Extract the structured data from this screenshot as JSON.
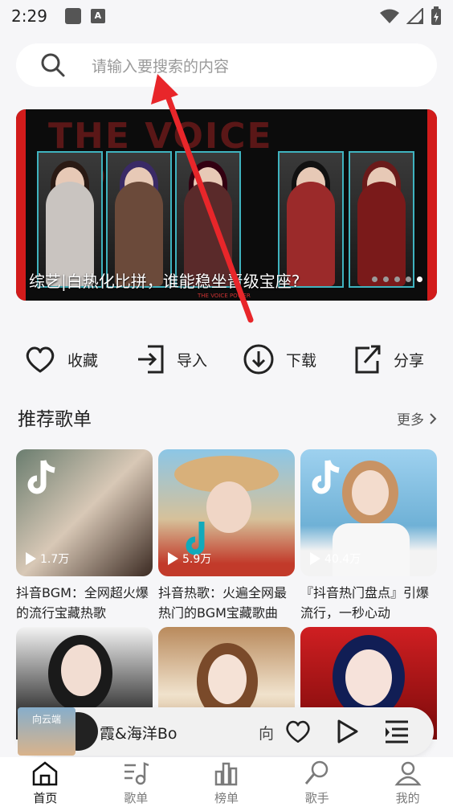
{
  "status_bar": {
    "time": "2:29"
  },
  "search": {
    "placeholder": "请输入要搜索的内容"
  },
  "banner": {
    "caption": "综艺|白热化比拼，谁能稳坐晋级宝座?",
    "brand_text": "THE VOICE POWER",
    "sub_text": "THE VOICE POWER"
  },
  "actions": [
    {
      "label": "收藏",
      "icon": "heart-icon"
    },
    {
      "label": "导入",
      "icon": "import-icon"
    },
    {
      "label": "下载",
      "icon": "download-icon"
    },
    {
      "label": "分享",
      "icon": "share-icon"
    }
  ],
  "recommend": {
    "title": "推荐歌单",
    "more": "更多",
    "playlists": [
      {
        "plays": "1.7万",
        "title": "抖音BGM：全网超火爆的流行宝藏热歌"
      },
      {
        "plays": "5.9万",
        "title": "抖音热歌：火遍全网最热门的BGM宝藏歌曲"
      },
      {
        "plays": "40.4万",
        "title": "『抖音热门盘点』引爆流行，一秒心动"
      }
    ]
  },
  "player": {
    "now_playing": "霞&海洋Bo",
    "next": "向",
    "art_text": "向云端"
  },
  "nav": [
    {
      "label": "首页",
      "icon": "home-icon",
      "active": true
    },
    {
      "label": "歌单",
      "icon": "playlist-icon",
      "active": false
    },
    {
      "label": "榜单",
      "icon": "chart-icon",
      "active": false
    },
    {
      "label": "歌手",
      "icon": "singer-icon",
      "active": false
    },
    {
      "label": "我的",
      "icon": "profile-icon",
      "active": false
    }
  ]
}
